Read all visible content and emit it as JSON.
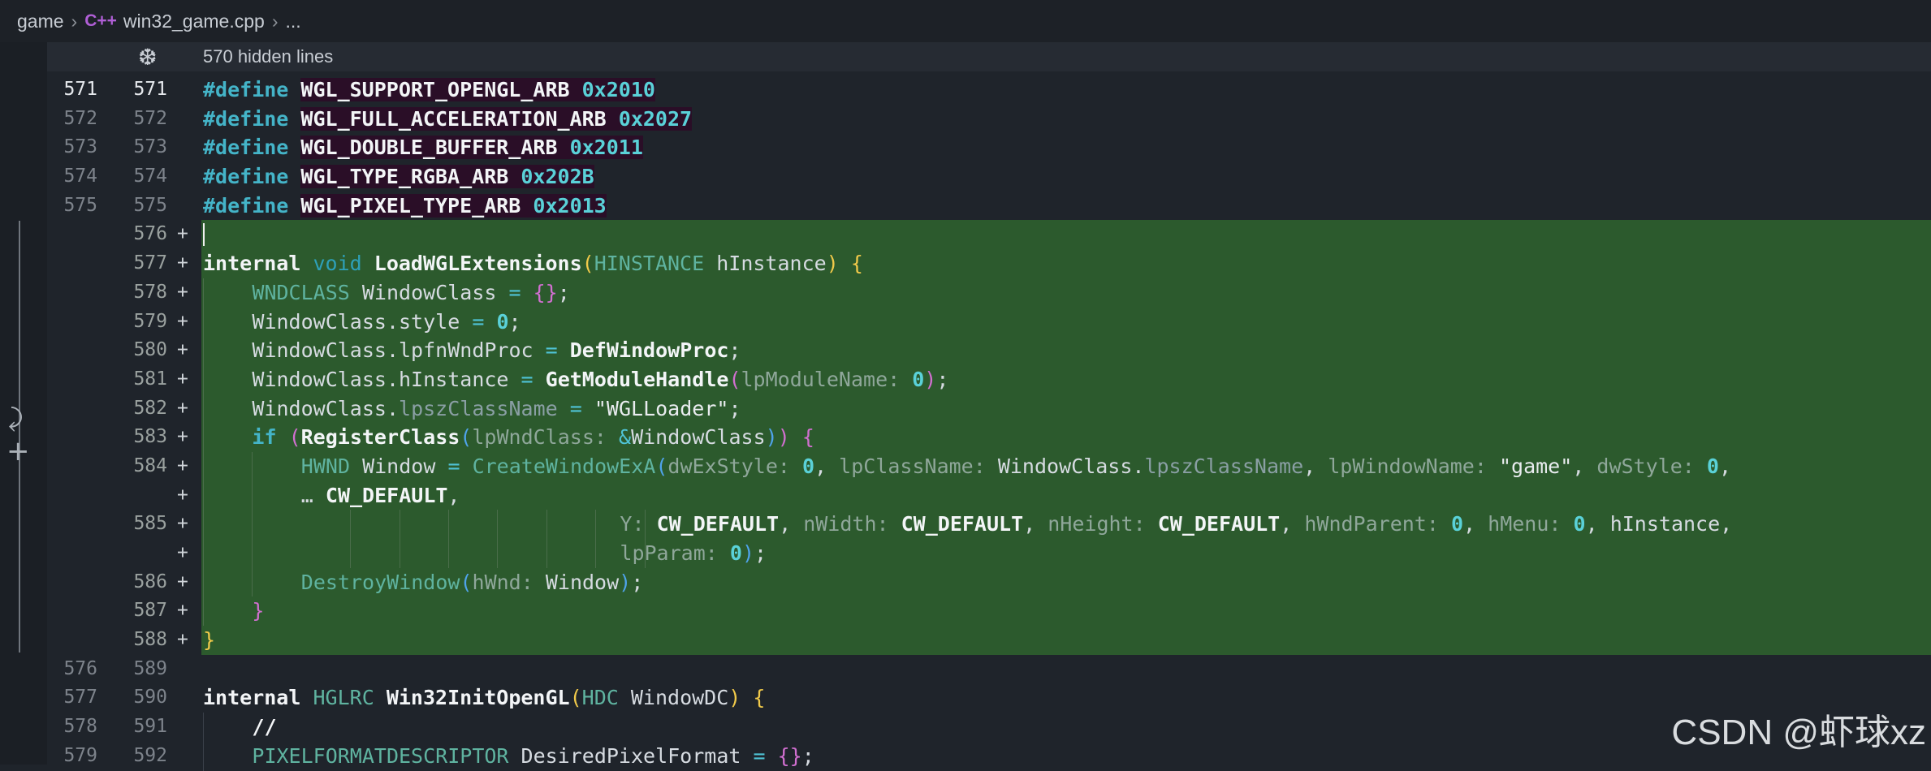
{
  "breadcrumb": {
    "folder": "game",
    "lang_icon": "C++",
    "file": "win32_game.cpp",
    "more": "..."
  },
  "hidden_bar": {
    "icon": "unfold-icon",
    "label": "570 hidden lines"
  },
  "watermark": "CSDN @虾球xz",
  "colors": {
    "added_background": "#2c5a2d",
    "keyword": "#44b4c8",
    "type": "#5fb3a0",
    "number": "#5ad1d8",
    "paren_yellow": "#f0c94a",
    "paren_pink": "#d16fd0"
  },
  "lines": [
    {
      "old": "571",
      "new": "571",
      "current": true,
      "add": false,
      "tokens": [
        [
          "kw",
          "#define"
        ],
        [
          "plain",
          " "
        ],
        [
          "hl ident",
          "WGL_SUPPORT_OPENGL_ARB"
        ],
        [
          "hl plain",
          " "
        ],
        [
          "hl num",
          "0x2010"
        ]
      ]
    },
    {
      "old": "572",
      "new": "572",
      "add": false,
      "tokens": [
        [
          "kw",
          "#define"
        ],
        [
          "plain",
          " "
        ],
        [
          "hl ident",
          "WGL_FULL_ACCELERATION_ARB"
        ],
        [
          "hl plain",
          " "
        ],
        [
          "hl num",
          "0x2027"
        ]
      ]
    },
    {
      "old": "573",
      "new": "573",
      "add": false,
      "tokens": [
        [
          "kw",
          "#define"
        ],
        [
          "plain",
          " "
        ],
        [
          "hl ident",
          "WGL_DOUBLE_BUFFER_ARB"
        ],
        [
          "hl plain",
          " "
        ],
        [
          "hl num",
          "0x2011"
        ]
      ]
    },
    {
      "old": "574",
      "new": "574",
      "add": false,
      "tokens": [
        [
          "kw",
          "#define"
        ],
        [
          "plain",
          " "
        ],
        [
          "hl ident",
          "WGL_TYPE_RGBA_ARB"
        ],
        [
          "hl plain",
          " "
        ],
        [
          "hl num",
          "0x202B"
        ]
      ]
    },
    {
      "old": "575",
      "new": "575",
      "add": false,
      "tokens": [
        [
          "kw",
          "#define"
        ],
        [
          "plain",
          " "
        ],
        [
          "hl ident",
          "WGL_PIXEL_TYPE_ARB"
        ],
        [
          "hl plain",
          " "
        ],
        [
          "hl num",
          "0x2013"
        ]
      ]
    },
    {
      "old": "",
      "new": "576",
      "add": true,
      "cursor": true,
      "tokens": []
    },
    {
      "old": "",
      "new": "577",
      "add": true,
      "tokens": [
        [
          "ident",
          "internal"
        ],
        [
          "plain",
          " "
        ],
        [
          "kwg",
          "void"
        ],
        [
          "plain",
          " "
        ],
        [
          "fn",
          "LoadWGLExtensions"
        ],
        [
          "paren-y",
          "("
        ],
        [
          "type",
          "HINSTANCE"
        ],
        [
          "plain",
          " hInstance"
        ],
        [
          "paren-y",
          ")"
        ],
        [
          "plain",
          " "
        ],
        [
          "paren-y",
          "{"
        ]
      ]
    },
    {
      "old": "",
      "new": "578",
      "add": true,
      "indent": 1,
      "tokens": [
        [
          "type",
          "WNDCLASS"
        ],
        [
          "plain",
          " WindowClass "
        ],
        [
          "op",
          "="
        ],
        [
          "plain",
          " "
        ],
        [
          "paren-p",
          "{}"
        ],
        [
          "plain",
          ";"
        ]
      ]
    },
    {
      "old": "",
      "new": "579",
      "add": true,
      "indent": 1,
      "tokens": [
        [
          "plain",
          "WindowClass.style "
        ],
        [
          "op",
          "="
        ],
        [
          "plain",
          " "
        ],
        [
          "num",
          "0"
        ],
        [
          "plain",
          ";"
        ]
      ]
    },
    {
      "old": "",
      "new": "580",
      "add": true,
      "indent": 1,
      "tokens": [
        [
          "plain",
          "WindowClass.lpfnWndProc "
        ],
        [
          "op",
          "="
        ],
        [
          "plain",
          " "
        ],
        [
          "fn",
          "DefWindowProc"
        ],
        [
          "plain",
          ";"
        ]
      ]
    },
    {
      "old": "",
      "new": "581",
      "add": true,
      "indent": 1,
      "tokens": [
        [
          "plain",
          "WindowClass.hInstance "
        ],
        [
          "op",
          "="
        ],
        [
          "plain",
          " "
        ],
        [
          "fn",
          "GetModuleHandle"
        ],
        [
          "paren-p",
          "("
        ],
        [
          "hint",
          "lpModuleName:"
        ],
        [
          "plain",
          " "
        ],
        [
          "num",
          "0"
        ],
        [
          "paren-p",
          ")"
        ],
        [
          "plain",
          ";"
        ]
      ]
    },
    {
      "old": "",
      "new": "582",
      "add": true,
      "indent": 1,
      "tokens": [
        [
          "plain",
          "WindowClass."
        ],
        [
          "dimid",
          "lpszClassName"
        ],
        [
          "plain",
          " "
        ],
        [
          "op",
          "="
        ],
        [
          "plain",
          " "
        ],
        [
          "str",
          "\"WGLLoader\""
        ],
        [
          "plain",
          ";"
        ]
      ]
    },
    {
      "old": "",
      "new": "583",
      "add": true,
      "indent": 1,
      "tokens": [
        [
          "kw",
          "if"
        ],
        [
          "plain",
          " "
        ],
        [
          "paren-p",
          "("
        ],
        [
          "fn",
          "RegisterClass"
        ],
        [
          "paren-b",
          "("
        ],
        [
          "hint",
          "lpWndClass:"
        ],
        [
          "plain",
          " "
        ],
        [
          "op",
          "&"
        ],
        [
          "plain",
          "WindowClass"
        ],
        [
          "paren-b",
          ")"
        ],
        [
          "paren-p",
          ")"
        ],
        [
          "plain",
          " "
        ],
        [
          "paren-p",
          "{"
        ]
      ]
    },
    {
      "old": "",
      "new": "584",
      "add": true,
      "indent": 2,
      "tokens": [
        [
          "type",
          "HWND"
        ],
        [
          "plain",
          " Window "
        ],
        [
          "op",
          "="
        ],
        [
          "plain",
          " "
        ],
        [
          "type",
          "CreateWindowExA"
        ],
        [
          "paren-b",
          "("
        ],
        [
          "hint",
          "dwExStyle:"
        ],
        [
          "plain",
          " "
        ],
        [
          "num",
          "0"
        ],
        [
          "plain",
          ", "
        ],
        [
          "hint",
          "lpClassName:"
        ],
        [
          "plain",
          " WindowClass."
        ],
        [
          "dimid",
          "lpszClassName"
        ],
        [
          "plain",
          ", "
        ],
        [
          "hint",
          "lpWindowName:"
        ],
        [
          "plain",
          " "
        ],
        [
          "str",
          "\"game\""
        ],
        [
          "plain",
          ", "
        ],
        [
          "hint",
          "dwStyle:"
        ],
        [
          "plain",
          " "
        ],
        [
          "num",
          "0"
        ],
        [
          "plain",
          ","
        ]
      ]
    },
    {
      "old": "",
      "new": "+",
      "add": true,
      "wrap": true,
      "indent": 2,
      "tokens": [
        [
          "plain",
          "… "
        ],
        [
          "fn",
          "CW_DEFAULT"
        ],
        [
          "plain",
          ","
        ]
      ]
    },
    {
      "old": "",
      "new": "585",
      "add": true,
      "indent": 2,
      "deep": true,
      "tokens": [
        [
          "hint",
          "Y:"
        ],
        [
          "plain",
          " "
        ],
        [
          "fn",
          "CW_DEFAULT"
        ],
        [
          "plain",
          ", "
        ],
        [
          "hint",
          "nWidth:"
        ],
        [
          "plain",
          " "
        ],
        [
          "fn",
          "CW_DEFAULT"
        ],
        [
          "plain",
          ", "
        ],
        [
          "hint",
          "nHeight:"
        ],
        [
          "plain",
          " "
        ],
        [
          "fn",
          "CW_DEFAULT"
        ],
        [
          "plain",
          ", "
        ],
        [
          "hint",
          "hWndParent:"
        ],
        [
          "plain",
          " "
        ],
        [
          "num",
          "0"
        ],
        [
          "plain",
          ", "
        ],
        [
          "hint",
          "hMenu:"
        ],
        [
          "plain",
          " "
        ],
        [
          "num",
          "0"
        ],
        [
          "plain",
          ", hInstance,"
        ]
      ]
    },
    {
      "old": "",
      "new": "+",
      "add": true,
      "wrap": true,
      "indent": 2,
      "deep": true,
      "tokens": [
        [
          "hint",
          "lpParam:"
        ],
        [
          "plain",
          " "
        ],
        [
          "num",
          "0"
        ],
        [
          "paren-b",
          ")"
        ],
        [
          "plain",
          ";"
        ]
      ]
    },
    {
      "old": "",
      "new": "586",
      "add": true,
      "indent": 2,
      "tokens": [
        [
          "type",
          "DestroyWindow"
        ],
        [
          "paren-b",
          "("
        ],
        [
          "hint",
          "hWnd:"
        ],
        [
          "plain",
          " Window"
        ],
        [
          "paren-b",
          ")"
        ],
        [
          "plain",
          ";"
        ]
      ]
    },
    {
      "old": "",
      "new": "587",
      "add": true,
      "indent": 1,
      "tokens": [
        [
          "paren-p",
          "}"
        ]
      ]
    },
    {
      "old": "",
      "new": "588",
      "add": true,
      "tokens": [
        [
          "paren-y",
          "}"
        ]
      ]
    },
    {
      "old": "576",
      "new": "589",
      "add": false,
      "tokens": []
    },
    {
      "old": "577",
      "new": "590",
      "add": false,
      "tokens": [
        [
          "ident",
          "internal"
        ],
        [
          "plain",
          " "
        ],
        [
          "type",
          "HGLRC"
        ],
        [
          "plain",
          " "
        ],
        [
          "fn",
          "Win32InitOpenGL"
        ],
        [
          "paren-y",
          "("
        ],
        [
          "type",
          "HDC"
        ],
        [
          "plain",
          " WindowDC"
        ],
        [
          "paren-y",
          ")"
        ],
        [
          "plain",
          " "
        ],
        [
          "paren-y",
          "{"
        ]
      ]
    },
    {
      "old": "578",
      "new": "591",
      "add": false,
      "indent": 1,
      "tokens": [
        [
          "ident",
          "//"
        ]
      ]
    },
    {
      "old": "579",
      "new": "592",
      "add": false,
      "indent": 1,
      "tokens": [
        [
          "type",
          "PIXELFORMATDESCRIPTOR"
        ],
        [
          "plain",
          " DesiredPixelFormat "
        ],
        [
          "op",
          "="
        ],
        [
          "plain",
          " "
        ],
        [
          "paren-p",
          "{}"
        ],
        [
          "plain",
          ";"
        ]
      ]
    }
  ]
}
